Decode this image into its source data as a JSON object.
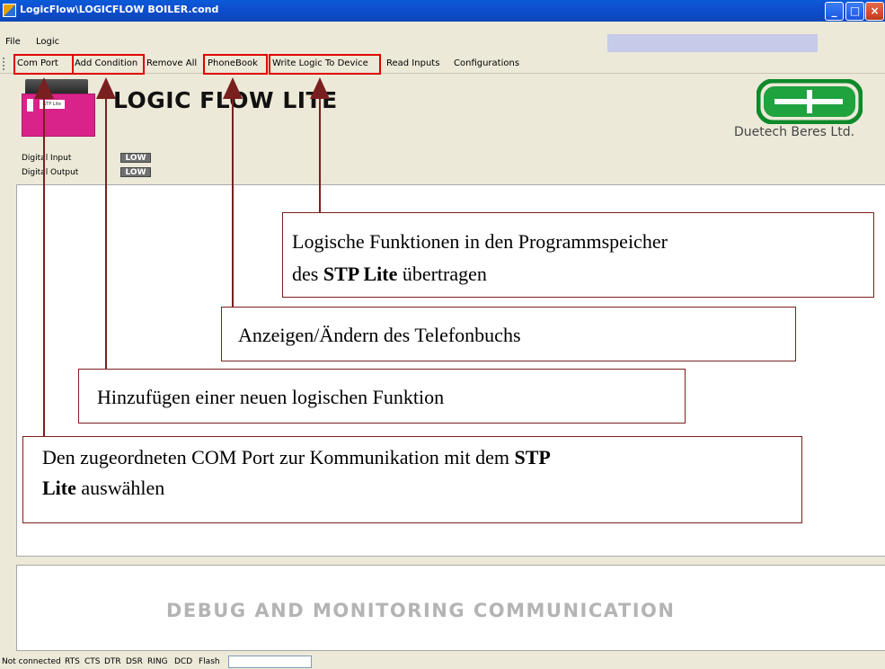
{
  "window": {
    "title": "LogicFlow\\LOGICFLOW BOILER.cond"
  },
  "menu": {
    "items": [
      "File",
      "Logic"
    ]
  },
  "toolbar": {
    "items": [
      "Com Port",
      "Add Condition",
      "Remove All",
      "PhoneBook",
      "Write Logic To Device",
      "Read Inputs",
      "Configurations"
    ]
  },
  "header": {
    "app_title": "LOGIC FLOW LITE",
    "device_label": "STP Lite",
    "company": "Duetech Beres Ltd."
  },
  "io": {
    "digital_input_label": "Digital Input",
    "digital_input_value": "LOW",
    "digital_output_label": "Digital Output",
    "digital_output_value": "LOW"
  },
  "callouts": {
    "write_logic": {
      "text1": "Logische Funktionen in den Programmspeicher",
      "text2a": "des ",
      "text2b": "STP Lite",
      "text2c": " übertragen"
    },
    "phonebook": "Anzeigen/Ändern des Telefonbuchs",
    "add_condition": "Hinzufügen einer neuen logischen Funktion",
    "com_port": {
      "text1a": "Den zugeordneten COM Port zur Kommunikation mit dem ",
      "text1b": "STP",
      "text2a": "Lite",
      "text2b": " auswählen"
    }
  },
  "debug": {
    "title": "DEBUG AND MONITORING COMMUNICATION"
  },
  "status": {
    "items": [
      "Not connected",
      "RTS",
      "CTS",
      "DTR",
      "DSR",
      "RING",
      "DCD",
      "Flash"
    ]
  },
  "colors": {
    "highlight": "#e00000",
    "arrow": "#7a1f1f",
    "title_bar": "#0a5bd8"
  }
}
